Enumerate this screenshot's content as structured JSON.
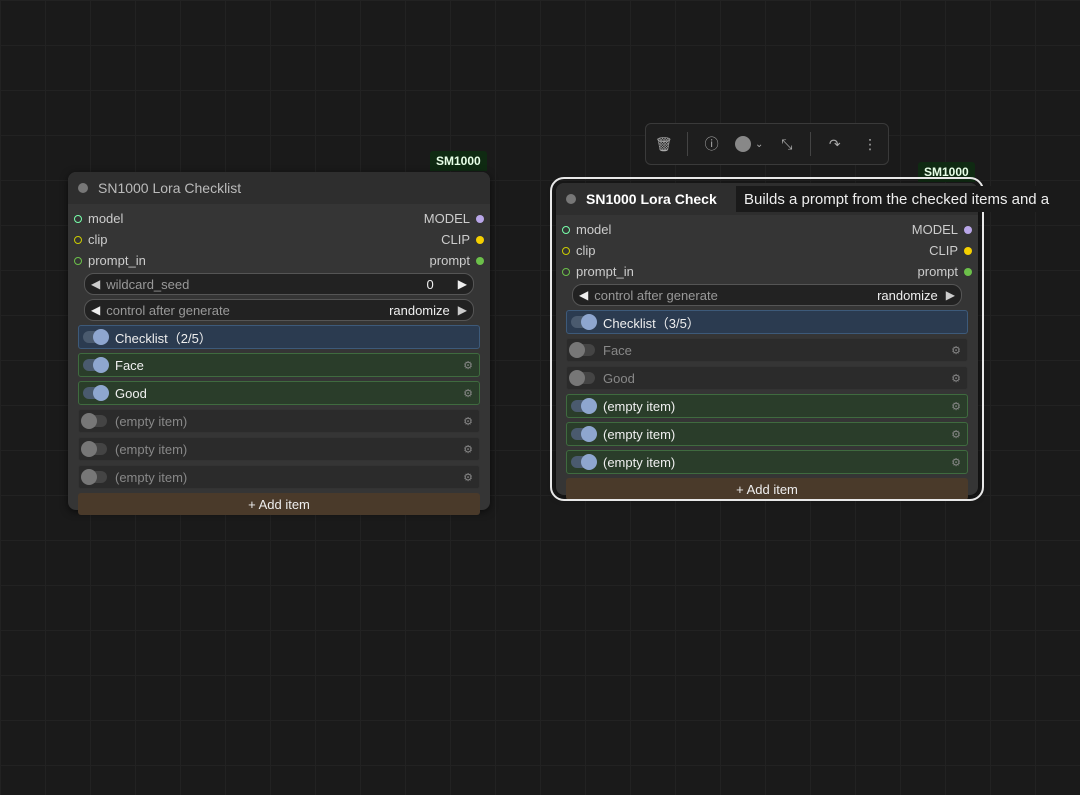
{
  "node_badge": "SM1000",
  "nodes": [
    {
      "title": "SN1000 Lora Checklist",
      "inputs": [
        {
          "in": "model",
          "out": "MODEL"
        },
        {
          "in": "clip",
          "out": "CLIP"
        },
        {
          "in": "prompt_in",
          "out": "prompt"
        }
      ],
      "seed_label": "wildcard_seed",
      "seed_value": "0",
      "control_label": "control after generate",
      "control_value": "randomize",
      "checklist_header": "Checklist（2/5）",
      "items": [
        "Face",
        "Good",
        "(empty item)",
        "(empty item)",
        "(empty item)"
      ],
      "add_label": "+ Add item"
    },
    {
      "title": "SN1000 Lora Check",
      "inputs": [
        {
          "in": "model",
          "out": "MODEL"
        },
        {
          "in": "clip",
          "out": "CLIP"
        },
        {
          "in": "prompt_in",
          "out": "prompt"
        }
      ],
      "control_label": "control after generate",
      "control_value": "randomize",
      "checklist_header": "Checklist（3/5）",
      "items": [
        "Face",
        "Good",
        "(empty item)",
        "(empty item)",
        "(empty item)"
      ],
      "add_label": "+ Add item"
    }
  ],
  "tooltip": "Builds a prompt from the checked items and a",
  "icons": {
    "delete": "trash-icon",
    "info": "info-icon",
    "color": "color-dot-icon",
    "collapse": "collapse-icon",
    "bypass": "redo-icon",
    "more": "more-vertical-icon"
  },
  "slot_colors": {
    "model": "#b9a6e8",
    "clip": "#f5d000",
    "prompt": "#6cc04a"
  }
}
